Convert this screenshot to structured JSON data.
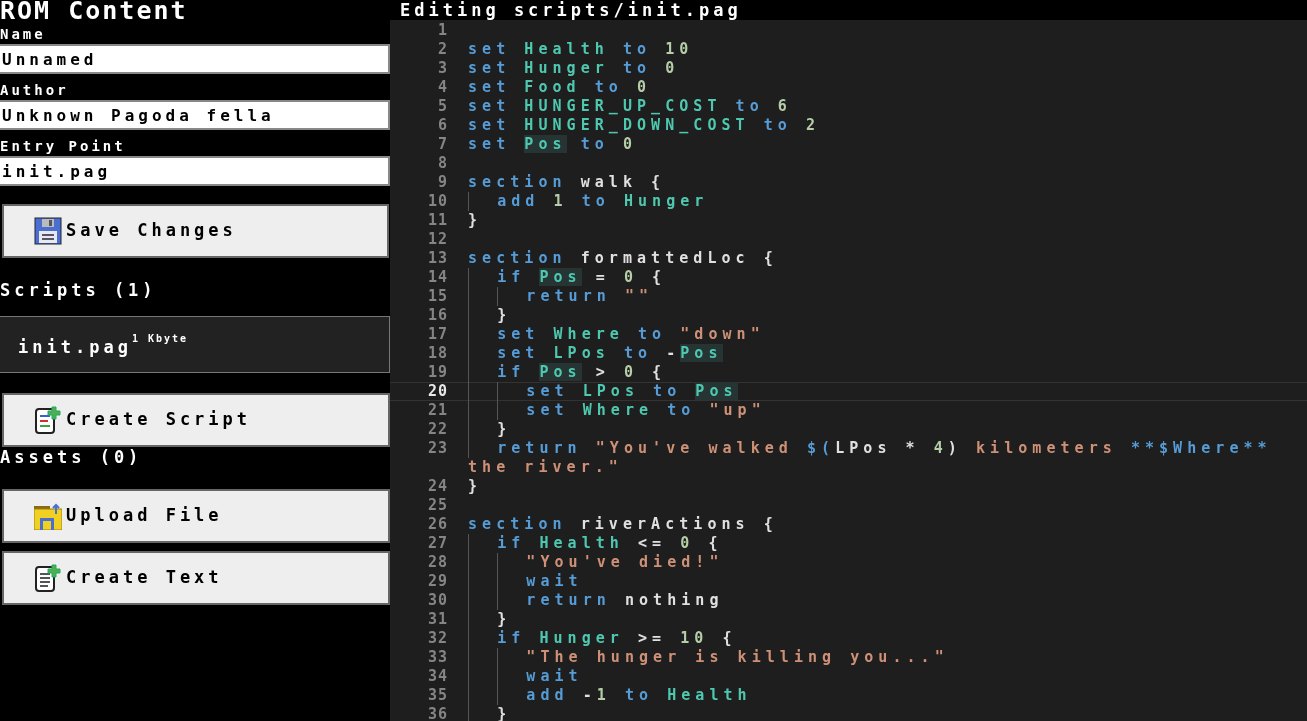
{
  "sidebar": {
    "title": "ROM Content",
    "fields": [
      {
        "label": "Name",
        "value": "Unnamed"
      },
      {
        "label": "Author",
        "value": "Unknown Pagoda fella"
      },
      {
        "label": "Entry Point",
        "value": "init.pag"
      }
    ],
    "save_button": "Save Changes",
    "scripts": {
      "heading": "Scripts (1)",
      "items": [
        {
          "name": "init.pag",
          "size": "1 Kbyte"
        }
      ],
      "button": "Create Script"
    },
    "assets": {
      "heading": "Assets (0)",
      "buttons": [
        {
          "kind": "upload",
          "label": "Upload File"
        },
        {
          "kind": "text",
          "label": "Create Text"
        }
      ]
    }
  },
  "editor": {
    "title": "Editing scripts/init.pag",
    "lines": [
      {
        "n": "1",
        "current": false
      },
      {
        "n": "2",
        "current": false,
        "tokens": [
          {
            "kind": "kw",
            "text": "set "
          },
          {
            "kind": "var",
            "text": "Health"
          },
          {
            "kind": "kw",
            "text": " to "
          },
          {
            "kind": "num",
            "text": "10"
          }
        ]
      },
      {
        "n": "3",
        "current": false,
        "tokens": [
          {
            "kind": "kw",
            "text": "set "
          },
          {
            "kind": "var",
            "text": "Hunger"
          },
          {
            "kind": "kw",
            "text": " to "
          },
          {
            "kind": "num",
            "text": "0"
          }
        ]
      },
      {
        "n": "4",
        "current": false,
        "tokens": [
          {
            "kind": "kw",
            "text": "set "
          },
          {
            "kind": "var",
            "text": "Food"
          },
          {
            "kind": "kw",
            "text": " to "
          },
          {
            "kind": "num",
            "text": "0"
          }
        ]
      },
      {
        "n": "5",
        "current": false,
        "tokens": [
          {
            "kind": "kw",
            "text": "set "
          },
          {
            "kind": "var",
            "text": "HUNGER_UP_COST"
          },
          {
            "kind": "kw",
            "text": " to "
          },
          {
            "kind": "num",
            "text": "6"
          }
        ]
      },
      {
        "n": "6",
        "current": false,
        "tokens": [
          {
            "kind": "kw",
            "text": "set "
          },
          {
            "kind": "var",
            "text": "HUNGER_DOWN_COST"
          },
          {
            "kind": "kw",
            "text": " to "
          },
          {
            "kind": "num",
            "text": "2"
          }
        ]
      },
      {
        "n": "7",
        "current": false,
        "tokens": [
          {
            "kind": "kw",
            "text": "set "
          },
          {
            "kind": "match",
            "text": "Pos"
          },
          {
            "kind": "kw",
            "text": " to "
          },
          {
            "kind": "num",
            "text": "0"
          }
        ]
      },
      {
        "n": "8",
        "current": false
      },
      {
        "n": "9",
        "current": false,
        "tokens": [
          {
            "kind": "kw",
            "text": "section "
          },
          {
            "kind": "plain",
            "text": "walk {"
          }
        ]
      },
      {
        "n": "10",
        "current": false,
        "tokens": [
          {
            "kind": "kw",
            "text": "  add "
          },
          {
            "kind": "num",
            "text": "1"
          },
          {
            "kind": "kw",
            "text": " to "
          },
          {
            "kind": "var",
            "text": "Hunger"
          }
        ]
      },
      {
        "n": "11",
        "current": false,
        "tokens": [
          {
            "kind": "plain",
            "text": "}"
          }
        ]
      },
      {
        "n": "12",
        "current": false
      },
      {
        "n": "13",
        "current": false,
        "tokens": [
          {
            "kind": "kw",
            "text": "section "
          },
          {
            "kind": "plain",
            "text": "formattedLoc {"
          }
        ]
      },
      {
        "n": "14",
        "current": false,
        "tokens": [
          {
            "kind": "kw",
            "text": "  if "
          },
          {
            "kind": "match",
            "text": "Pos"
          },
          {
            "kind": "plain",
            "text": " = "
          },
          {
            "kind": "num",
            "text": "0"
          },
          {
            "kind": "plain",
            "text": " {"
          }
        ]
      },
      {
        "n": "15",
        "current": false,
        "tokens": [
          {
            "kind": "kw",
            "text": "    return "
          },
          {
            "kind": "str",
            "text": "\"\""
          }
        ]
      },
      {
        "n": "16",
        "current": false,
        "tokens": [
          {
            "kind": "plain",
            "text": "  }"
          }
        ]
      },
      {
        "n": "17",
        "current": false,
        "tokens": [
          {
            "kind": "kw",
            "text": "  set "
          },
          {
            "kind": "var",
            "text": "Where"
          },
          {
            "kind": "kw",
            "text": " to "
          },
          {
            "kind": "str",
            "text": "\"down\""
          }
        ]
      },
      {
        "n": "18",
        "current": false,
        "tokens": [
          {
            "kind": "kw",
            "text": "  set "
          },
          {
            "kind": "var",
            "text": "LPos"
          },
          {
            "kind": "kw",
            "text": " to "
          },
          {
            "kind": "plain",
            "text": "-"
          },
          {
            "kind": "match",
            "text": "Pos"
          }
        ]
      },
      {
        "n": "19",
        "current": false,
        "tokens": [
          {
            "kind": "kw",
            "text": "  if "
          },
          {
            "kind": "match",
            "text": "Pos"
          },
          {
            "kind": "plain",
            "text": " > "
          },
          {
            "kind": "num",
            "text": "0"
          },
          {
            "kind": "plain",
            "text": " {"
          }
        ]
      },
      {
        "n": "20",
        "current": true,
        "tokens": [
          {
            "kind": "kw",
            "text": "    set "
          },
          {
            "kind": "var",
            "text": "LPos"
          },
          {
            "kind": "kw",
            "text": " to "
          },
          {
            "kind": "match",
            "text": "Pos"
          }
        ]
      },
      {
        "n": "21",
        "current": false,
        "tokens": [
          {
            "kind": "kw",
            "text": "    set "
          },
          {
            "kind": "var",
            "text": "Where"
          },
          {
            "kind": "kw",
            "text": " to "
          },
          {
            "kind": "str",
            "text": "\"up\""
          }
        ]
      },
      {
        "n": "22",
        "current": false,
        "tokens": [
          {
            "kind": "plain",
            "text": "  }"
          }
        ]
      },
      {
        "n": "23",
        "current": false,
        "tokens": [
          {
            "kind": "kw",
            "text": "  return "
          },
          {
            "kind": "str",
            "text": "\"You've walked "
          },
          {
            "kind": "kw",
            "text": "$("
          },
          {
            "kind": "plain",
            "text": "LPos * "
          },
          {
            "kind": "num",
            "text": "4"
          },
          {
            "kind": "plain",
            "text": ") "
          },
          {
            "kind": "str",
            "text": "kilometers "
          },
          {
            "kind": "kw",
            "text": "**$Where**"
          },
          {
            "kind": "str",
            "text": " the river.\""
          }
        ]
      },
      {
        "n": "24",
        "current": false,
        "tokens": [
          {
            "kind": "plain",
            "text": "}"
          }
        ]
      },
      {
        "n": "25",
        "current": false
      },
      {
        "n": "26",
        "current": false,
        "tokens": [
          {
            "kind": "kw",
            "text": "section "
          },
          {
            "kind": "plain",
            "text": "riverActions {"
          }
        ]
      },
      {
        "n": "27",
        "current": false,
        "tokens": [
          {
            "kind": "kw",
            "text": "  if "
          },
          {
            "kind": "var",
            "text": "Health"
          },
          {
            "kind": "plain",
            "text": " <= "
          },
          {
            "kind": "num",
            "text": "0"
          },
          {
            "kind": "plain",
            "text": " {"
          }
        ]
      },
      {
        "n": "28",
        "current": false,
        "tokens": [
          {
            "kind": "str",
            "text": "    \"You've died!\""
          }
        ]
      },
      {
        "n": "29",
        "current": false,
        "tokens": [
          {
            "kind": "kw",
            "text": "    wait"
          }
        ]
      },
      {
        "n": "30",
        "current": false,
        "tokens": [
          {
            "kind": "kw",
            "text": "    return "
          },
          {
            "kind": "plain",
            "text": "nothing"
          }
        ]
      },
      {
        "n": "31",
        "current": false,
        "tokens": [
          {
            "kind": "plain",
            "text": "  }"
          }
        ]
      },
      {
        "n": "32",
        "current": false,
        "tokens": [
          {
            "kind": "kw",
            "text": "  if "
          },
          {
            "kind": "var",
            "text": "Hunger"
          },
          {
            "kind": "plain",
            "text": " >= "
          },
          {
            "kind": "num",
            "text": "10"
          },
          {
            "kind": "plain",
            "text": " {"
          }
        ]
      },
      {
        "n": "33",
        "current": false,
        "tokens": [
          {
            "kind": "str",
            "text": "    \"The hunger is killing you...\""
          }
        ]
      },
      {
        "n": "34",
        "current": false,
        "tokens": [
          {
            "kind": "kw",
            "text": "    wait"
          }
        ]
      },
      {
        "n": "35",
        "current": false,
        "tokens": [
          {
            "kind": "kw",
            "text": "    add "
          },
          {
            "kind": "plain",
            "text": "-"
          },
          {
            "kind": "num",
            "text": "1"
          },
          {
            "kind": "kw",
            "text": " to "
          },
          {
            "kind": "var",
            "text": "Health"
          }
        ]
      },
      {
        "n": "36",
        "current": false,
        "tokens": [
          {
            "kind": "plain",
            "text": "  }"
          }
        ]
      }
    ]
  }
}
